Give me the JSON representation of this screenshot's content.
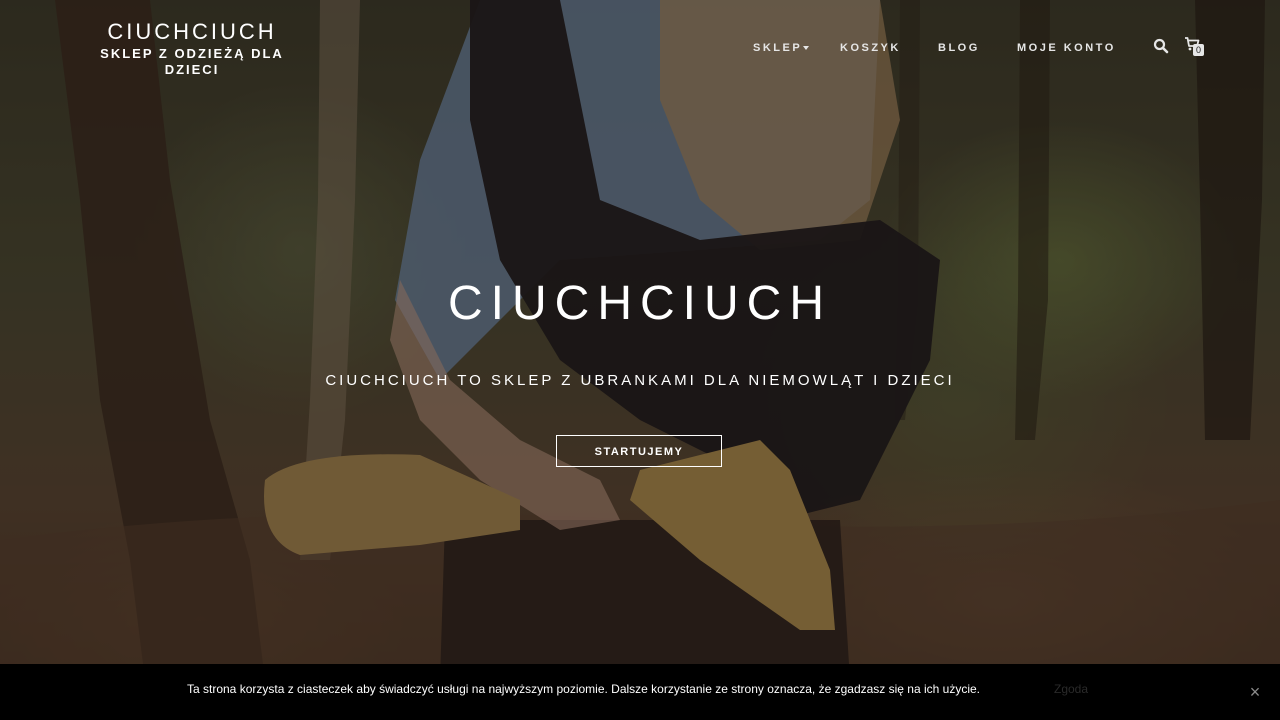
{
  "header": {
    "site_title": "CIUCHCIUCH",
    "tagline_line1": "SKLEP Z ODZIEŻĄ DLA",
    "tagline_line2": "DZIECI",
    "nav": {
      "shop": "SKLEP",
      "cart": "KOSZYK",
      "blog": "BLOG",
      "account": "MOJE KONTO"
    },
    "search_icon": "search-icon",
    "cart_icon": "cart-icon",
    "cart_count": "0"
  },
  "hero": {
    "title": "CIUCHCIUCH",
    "subtitle": "CIUCHCIUCH TO SKLEP Z UBRANKAMI DLA NIEMOWLĄT I DZIECI",
    "cta_label": "STARTUJEMY",
    "background": "forest-photo"
  },
  "cookie_bar": {
    "message": "Ta strona korzysta z ciasteczek aby świadczyć usługi na najwyższym poziomie. Dalsze korzystanie ze strony oznacza, że zgadzasz się na ich użycie.",
    "accept_label": "Zgoda",
    "close_label": "×"
  },
  "colors": {
    "text": "#ffffff",
    "cookie_bg": "#000000",
    "nav_text": "#e6e6e6"
  }
}
